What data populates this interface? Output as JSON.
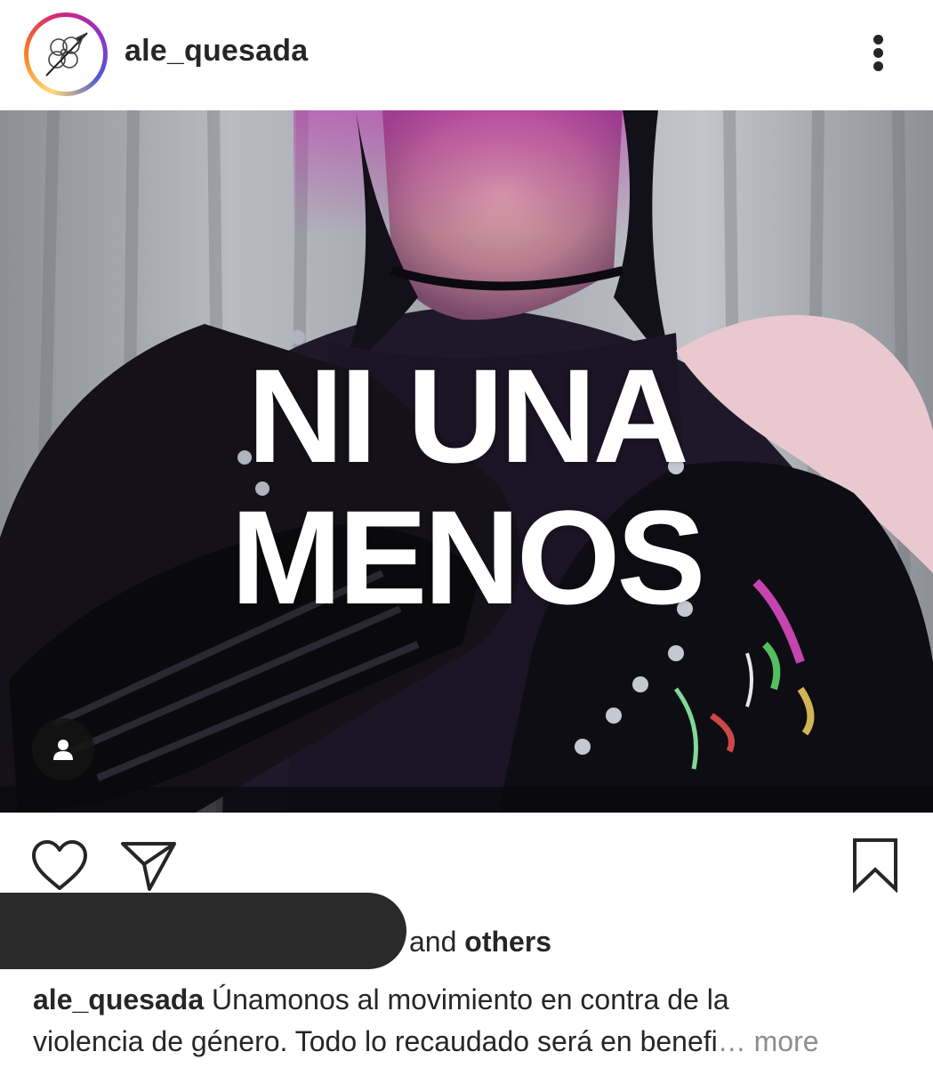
{
  "header": {
    "username": "ale_quesada",
    "avatar_icon": "feather-flower-logo-icon",
    "menu_icon": "more-vertical-icon"
  },
  "post": {
    "overlay_line1": "NI UNA",
    "overlay_line2": "MENOS",
    "tag_icon": "user-tag-icon"
  },
  "actions": {
    "like_icon": "heart-outline-icon",
    "share_icon": "paper-plane-icon",
    "save_icon": "bookmark-outline-icon"
  },
  "likes": {
    "and_text": "and",
    "others_text": "others"
  },
  "caption": {
    "username": "ale_quesada",
    "line1": "Únamonos al movimiento en contra de la",
    "line2": "violencia de género. Todo lo recaudado será en benefi",
    "ellipsis": "…",
    "more": "more"
  },
  "colors": {
    "text": "#262626",
    "muted": "#8e8e8e",
    "redaction": "#2a2a2a"
  }
}
